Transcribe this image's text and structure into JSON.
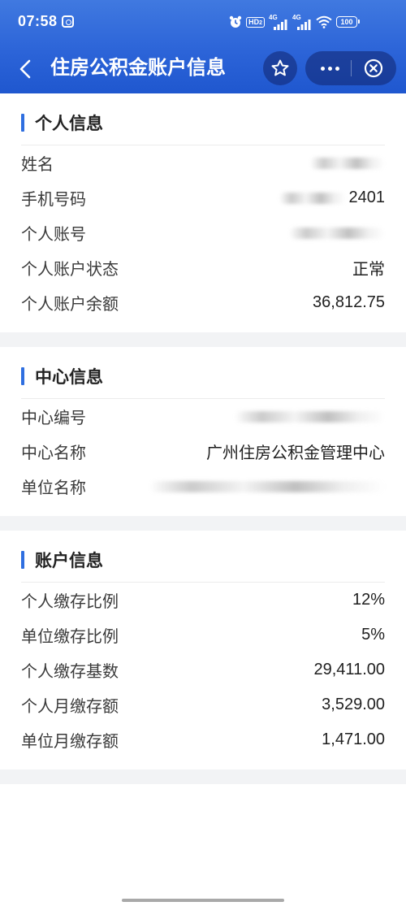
{
  "status_bar": {
    "time": "07:58",
    "hd_label": "HD",
    "hd_sub": "2",
    "network_1": "4G",
    "network_2": "4G",
    "battery": "100",
    "icons": [
      "app-notification-icon",
      "alarm-icon",
      "hd-voice-icon",
      "signal-icon",
      "signal-icon",
      "wifi-icon",
      "battery-icon"
    ]
  },
  "nav": {
    "title": "住房公积金账户信息",
    "icons": {
      "back": "chevron-left-icon",
      "favorite": "star-outline-icon",
      "more": "more-dots-icon",
      "close": "close-circle-icon"
    }
  },
  "sections": [
    {
      "title": "个人信息",
      "rows": [
        {
          "label": "姓名",
          "redacted": true
        },
        {
          "label": "手机号码",
          "value": "2401",
          "redacted_prefix": true
        },
        {
          "label": "个人账号",
          "redacted": true
        },
        {
          "label": "个人账户状态",
          "value": "正常"
        },
        {
          "label": "个人账户余额",
          "value": "36,812.75"
        }
      ]
    },
    {
      "title": "中心信息",
      "rows": [
        {
          "label": "中心编号",
          "redacted": true
        },
        {
          "label": "中心名称",
          "value": "广州住房公积金管理中心"
        },
        {
          "label": "单位名称",
          "redacted": true
        }
      ]
    },
    {
      "title": "账户信息",
      "rows": [
        {
          "label": "个人缴存比例",
          "value": "12%"
        },
        {
          "label": "单位缴存比例",
          "value": "5%"
        },
        {
          "label": "个人缴存基数",
          "value": "29,411.00"
        },
        {
          "label": "个人月缴存额",
          "value": "3,529.00"
        },
        {
          "label": "单位月缴存额",
          "value": "1,471.00"
        }
      ]
    }
  ],
  "colors": {
    "header_top": "#4079e0",
    "header_bottom": "#1f57cf",
    "accent_bar": "#2f6fe0",
    "page_gap": "#f2f3f5",
    "label_text": "#3a3a3a",
    "value_text": "#1f1f1f"
  }
}
